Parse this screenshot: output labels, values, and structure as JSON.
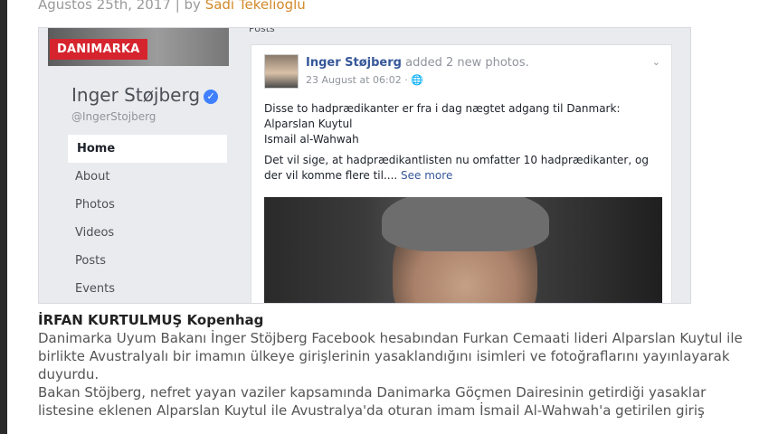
{
  "meta": {
    "date": "Ağustos 25th, 2017 | by ",
    "author": "Sadi Tekelioğlu"
  },
  "profile": {
    "badge": "DANIMARKA",
    "name": "Inger Støjberg",
    "handle": "@IngerStojberg",
    "nav": [
      "Home",
      "About",
      "Photos",
      "Videos",
      "Posts",
      "Events"
    ]
  },
  "post": {
    "section_label": "Posts",
    "author": "Inger Støjberg",
    "action": "added 2 new photos.",
    "date": "23 August at 06:02 · ",
    "lines": [
      "Disse to hadprædikanter er fra i dag nægtet adgang til Danmark:",
      "Alparslan Kuytul",
      "Ismail al-Wahwah"
    ],
    "continued": "Det vil sige, at hadprædikantlisten nu omfatter 10 hadprædikanter, og der vil komme flere til....",
    "see_more": "See more"
  },
  "article": {
    "headline": "İRFAN KURTULMUŞ Kopenhag",
    "paragraph1": "Danimarka Uyum Bakanı İnger Stöjberg Facebook hesabından Furkan Cemaati lideri Alparslan Kuytul ile birlikte Avustralyalı bir imamın ülkeye girişlerinin yasaklandığını isimleri ve fotoğraflarını yayınlayarak duyurdu.",
    "paragraph2": "Bakan Stöjberg, nefret yayan vaziler kapsamında Danimarka Göçmen Dairesinin getirdiği yasaklar listesine eklenen Alparslan Kuytul ile Avustralya'da oturan imam İsmail Al-Wahwah'a getirilen giriş"
  }
}
